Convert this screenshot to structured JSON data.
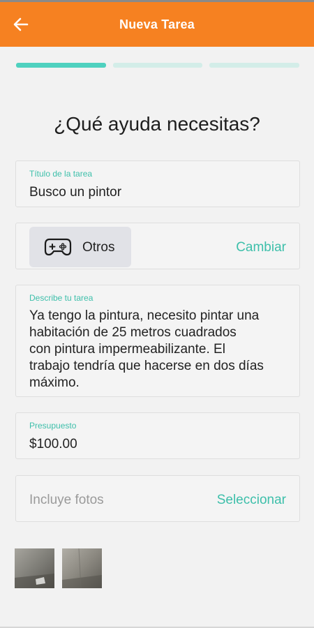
{
  "colors": {
    "app_bar": "#f68121",
    "accent": "#3dbfaa",
    "step_active": "#4fd1bf",
    "step_inactive": "#d3ede8"
  },
  "app_bar": {
    "title": "Nueva Tarea",
    "back_icon": "arrow-left-icon"
  },
  "progress": {
    "current_step": 1,
    "total_steps": 3
  },
  "heading": "¿Qué ayuda necesitas?",
  "title_field": {
    "label": "Título de la tarea",
    "value": "Busco un pintor"
  },
  "category": {
    "icon": "gamepad-icon",
    "label": "Otros",
    "change_label": "Cambiar"
  },
  "description_field": {
    "label": "Describe tu tarea",
    "lines": [
      "Ya tengo la pintura, necesito pintar una",
      "habitación de 25 metros cuadrados",
      "con pintura impermeabilizante. El",
      "trabajo tendría que hacerse en dos días",
      "máximo."
    ]
  },
  "budget_field": {
    "label": "Presupuesto",
    "value": "$100.00"
  },
  "photos": {
    "placeholder": "Incluye fotos",
    "select_label": "Seleccionar"
  }
}
